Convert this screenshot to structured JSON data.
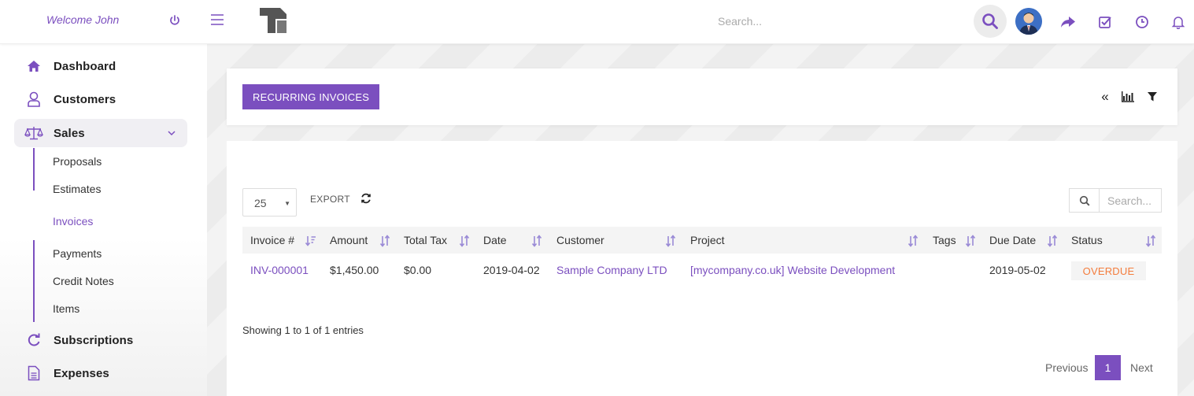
{
  "header": {
    "welcome": "Welcome John",
    "search_placeholder": "Search...",
    "icons": [
      "power-icon",
      "menu-icon",
      "search-icon",
      "share-icon",
      "checkbox-icon",
      "clock-icon",
      "bell-icon"
    ]
  },
  "sidebar": {
    "items": [
      {
        "label": "Dashboard",
        "icon": "home-icon"
      },
      {
        "label": "Customers",
        "icon": "user-icon"
      },
      {
        "label": "Sales",
        "icon": "balance-scale-icon",
        "expanded": true
      },
      {
        "label": "Subscriptions",
        "icon": "refresh-icon"
      },
      {
        "label": "Expenses",
        "icon": "file-icon"
      }
    ],
    "sales_sub": [
      "Proposals",
      "Estimates",
      "Invoices",
      "Payments",
      "Credit Notes",
      "Items"
    ]
  },
  "toolbar": {
    "primary_button": "RECURRING INVOICES",
    "toggle_label": "«"
  },
  "table": {
    "page_length": "25",
    "export_label": "EXPORT",
    "search_placeholder": "Search...",
    "columns": [
      "Invoice #",
      "Amount",
      "Total Tax",
      "Date",
      "Customer",
      "Project",
      "Tags",
      "Due Date",
      "Status"
    ],
    "rows": [
      {
        "invoice": "INV-000001",
        "amount": "$1,450.00",
        "total_tax": "$0.00",
        "date": "2019-04-02",
        "customer": "Sample Company LTD",
        "project": "[mycompany.co.uk] Website Development",
        "tags": "",
        "due_date": "2019-05-02",
        "status": "OVERDUE"
      }
    ],
    "info": "Showing 1 to 1 of 1 entries"
  },
  "pagination": {
    "previous": "Previous",
    "current": "1",
    "next": "Next"
  },
  "colors": {
    "accent": "#7b4fbf",
    "overdue": "#f47c3c"
  }
}
